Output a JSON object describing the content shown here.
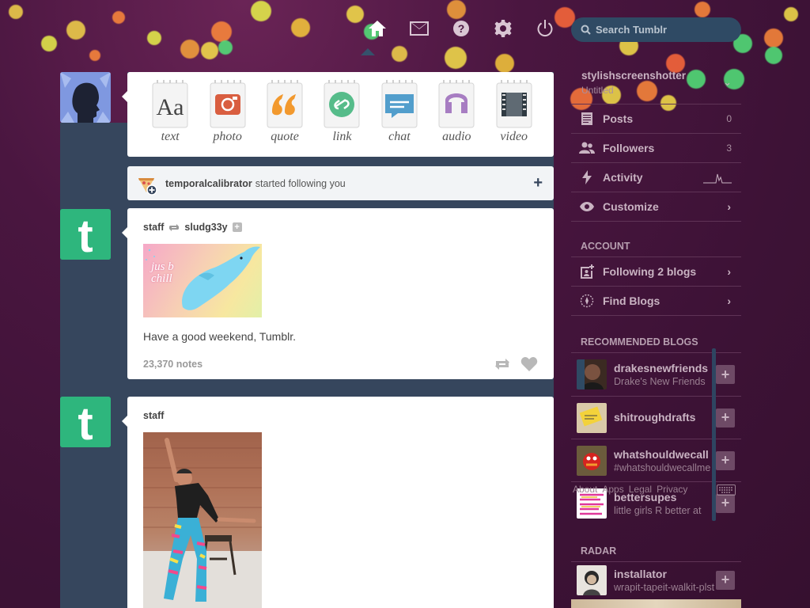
{
  "header": {
    "nav": [
      {
        "icon": "home-icon",
        "label": "Dashboard"
      },
      {
        "icon": "mail-icon",
        "label": "Messages"
      },
      {
        "icon": "help-icon",
        "label": "Help"
      },
      {
        "icon": "gear-icon",
        "label": "Settings"
      },
      {
        "icon": "power-icon",
        "label": "Log out"
      }
    ],
    "search_placeholder": "Search Tumblr"
  },
  "post_types": [
    {
      "label": "text",
      "color": "#555555"
    },
    {
      "label": "photo",
      "color": "#d95e40"
    },
    {
      "label": "quote",
      "color": "#f2992e"
    },
    {
      "label": "link",
      "color": "#56bc8a"
    },
    {
      "label": "chat",
      "color": "#529ecc"
    },
    {
      "label": "audio",
      "color": "#a77dc2"
    },
    {
      "label": "video",
      "color": "#748089"
    }
  ],
  "notification": {
    "user": "temporalcalibrator",
    "text": "started following you"
  },
  "posts": [
    {
      "author": "staff",
      "reblogged_from": "sludg33y",
      "image_text": "jus b chill",
      "caption": "Have a good weekend, Tumblr.",
      "notes": "23,370 notes"
    },
    {
      "author": "staff"
    }
  ],
  "sidebar": {
    "blog_name": "stylishscreenshotter",
    "blog_title": "Untitled",
    "items": [
      {
        "label": "Posts",
        "count": "0"
      },
      {
        "label": "Followers",
        "count": "3"
      },
      {
        "label": "Activity"
      },
      {
        "label": "Customize"
      }
    ],
    "account_heading": "ACCOUNT",
    "account_items": [
      {
        "label": "Following 2 blogs"
      },
      {
        "label": "Find Blogs"
      }
    ],
    "recommended_heading": "RECOMMENDED BLOGS",
    "recommended": [
      {
        "name": "drakesnewfriends",
        "desc": "Drake's New Friends"
      },
      {
        "name": "shitroughdrafts",
        "desc": ""
      },
      {
        "name": "whatshouldwecall",
        "desc": "#whatshouldwecallme"
      },
      {
        "name": "bettersupes",
        "desc": "little girls R better at"
      }
    ],
    "footer_links": [
      "About",
      "Apps",
      "Legal",
      "Privacy"
    ],
    "radar_heading": "RADAR",
    "radar": {
      "name": "installator",
      "desc": "wrapit-tapeit-walkit-plst"
    }
  },
  "colors": {
    "background": "#4a1640",
    "dashboard": "#36465d",
    "tumblr_green": "#2eb67d",
    "search_bg": "#2f4a64"
  }
}
